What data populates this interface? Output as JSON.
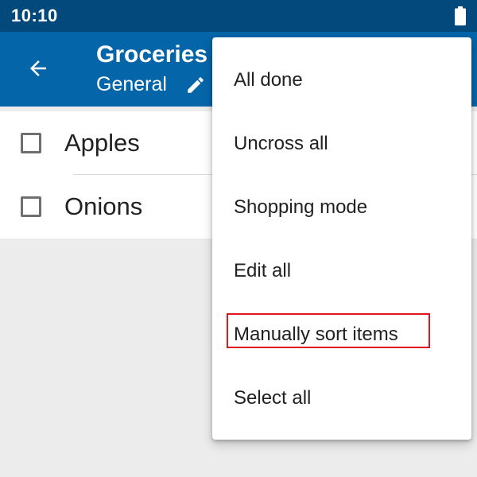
{
  "status_bar": {
    "time": "10:10",
    "battery_icon": "battery-full-icon"
  },
  "app_bar": {
    "back_icon": "arrow-back-icon",
    "title": "Groceries",
    "subtitle": "General",
    "edit_icon": "pencil-icon",
    "background_color": "#0565a9"
  },
  "list": {
    "items": [
      {
        "label": "Apples",
        "checked": false
      },
      {
        "label": "Onions",
        "checked": false
      }
    ]
  },
  "menu": {
    "items": [
      {
        "label": "All done"
      },
      {
        "label": "Uncross all"
      },
      {
        "label": "Shopping mode"
      },
      {
        "label": "Edit all"
      },
      {
        "label": "Manually sort items",
        "highlighted": true
      },
      {
        "label": "Select all"
      }
    ],
    "highlight_color": "#e0161b"
  }
}
